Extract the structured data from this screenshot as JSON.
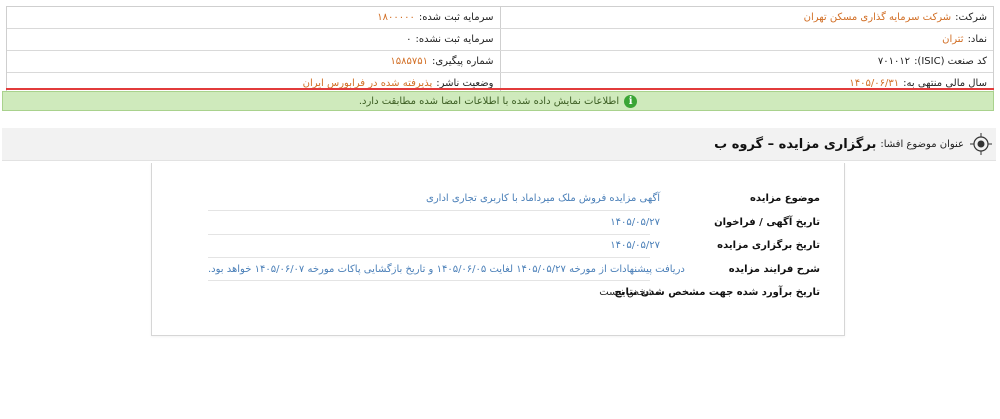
{
  "company_info": {
    "company_label": "شرکت:",
    "company_value": "شرکت سرمایه گذاری مسکن تهران",
    "registered_capital_label": "سرمایه ثبت شده:",
    "registered_capital_value": "۱۸۰۰۰۰۰",
    "symbol_label": "نماد:",
    "symbol_value": "ثتران",
    "unregistered_capital_label": "سرمایه ثبت نشده:",
    "unregistered_capital_value": "۰",
    "isic_label": "کد صنعت (ISIC):",
    "isic_value": "۷۰۱۰۱۲",
    "tracking_label": "شماره پیگیری:",
    "tracking_value": "۱۵۸۵۷۵۱",
    "fiscal_year_label": "سال مالی منتهی به:",
    "fiscal_year_value": "۱۴۰۵/۰۶/۳۱",
    "publisher_status_label": "وضعیت ناشر:",
    "publisher_status_value": "پذیرفته شده در فرابورس ایران"
  },
  "notice": {
    "icon": "info-icon",
    "text": "اطلاعات نمایش داده شده با اطلاعات امضا شده مطابقت دارد.",
    "color": "#cfeabc"
  },
  "subject": {
    "icon": "target-icon",
    "label": "عنوان موضوع افشا:",
    "title": "برگزاری مزایده – گروه ب"
  },
  "details": [
    {
      "label": "موضوع مزایده",
      "value": "آگهی مزایده فروش ملک میرداماد با کاربری تجاری اداری"
    },
    {
      "label": "تاریخ آگهی / فراخوان",
      "value": "۱۴۰۵/۰۵/۲۷"
    },
    {
      "label": "تاریخ برگزاری مزایده",
      "value": "۱۴۰۵/۰۵/۲۷"
    },
    {
      "label": "شرح فرایند مزایده",
      "value": "دریافت پیشنهادات از مورخه ۱۴۰۵/۰۵/۲۷ لغایت ۱۴۰۵/۰۶/۰۵ و تاریخ بازگشایی پاکات مورخه ۱۴۰۵/۰۶/۰۷ خواهد بود."
    },
    {
      "label": "تاریخ برآورد شده جهت مشخص شدن نتایج",
      "value": "مشخص نیست"
    }
  ],
  "colors": {
    "accent_orange": "#d26f26",
    "link_blue": "#4a7fb8",
    "alert_red": "#e23b3b"
  }
}
